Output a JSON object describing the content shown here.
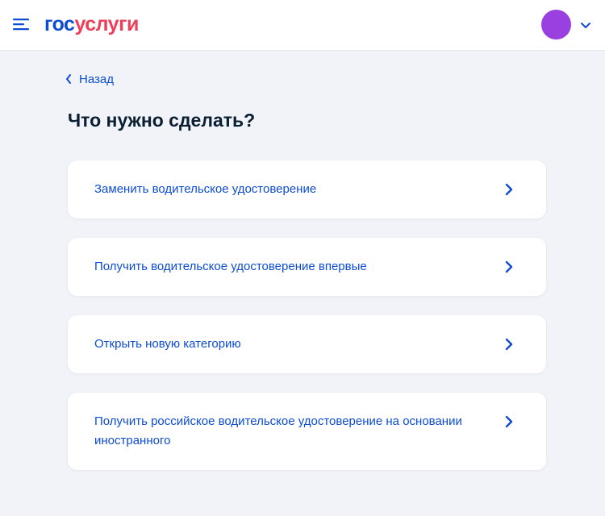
{
  "header": {
    "logo_part1": "гос",
    "logo_part2": "услуги",
    "menu_icon": "burger-menu-icon",
    "avatar_color": "#9a3fe0",
    "chevron_icon": "chevron-down-icon"
  },
  "nav": {
    "back_label": "Назад"
  },
  "page": {
    "title": "Что нужно сделать?"
  },
  "options": [
    {
      "label": "Заменить водительское удостоверение"
    },
    {
      "label": "Получить водительское удостоверение впервые"
    },
    {
      "label": "Открыть новую категорию"
    },
    {
      "label": "Получить российское водительское удостоверение на основании иностранного"
    }
  ],
  "colors": {
    "brand_blue": "#0d4cd3",
    "brand_red": "#ee3f58",
    "background": "#f1f3f8",
    "text_dark": "#0b1f33"
  }
}
